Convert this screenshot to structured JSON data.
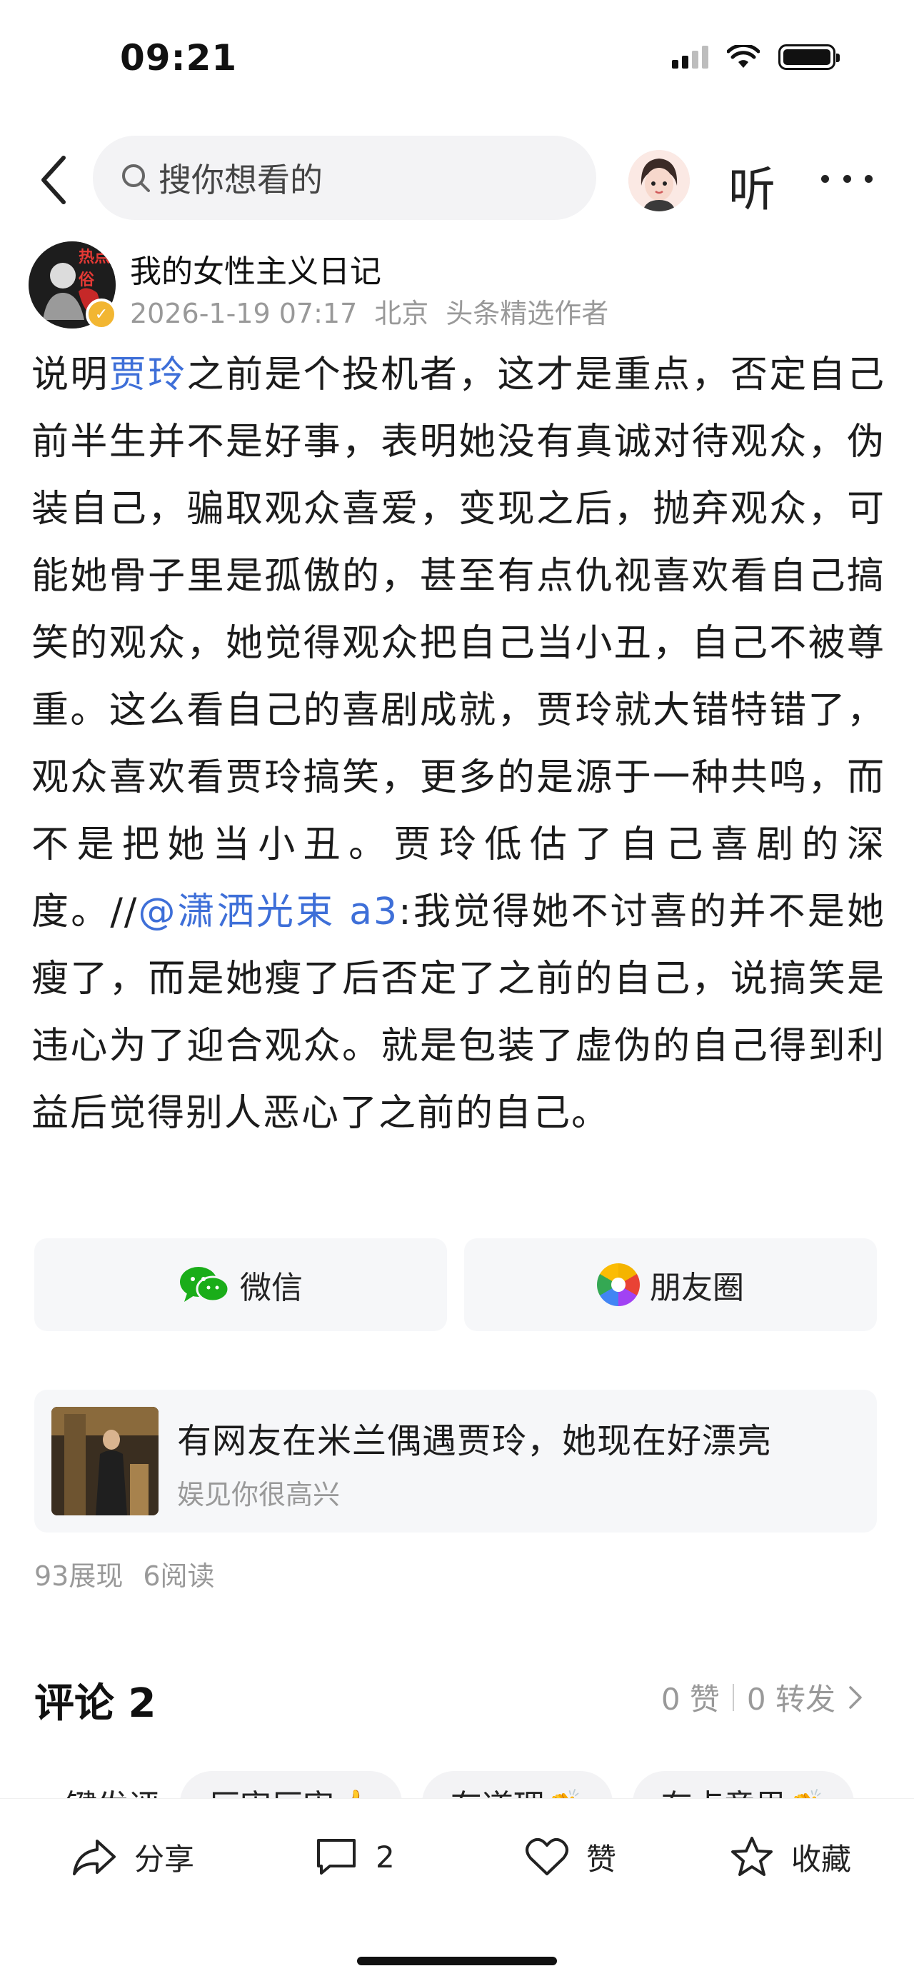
{
  "status_bar": {
    "time": "09:21"
  },
  "nav": {
    "search_placeholder": "搜你想看的",
    "listen_label": "听"
  },
  "author": {
    "name": "我的女性主义日记",
    "date": "2026-1-19 07:17",
    "location": "北京",
    "tag": "头条精选作者",
    "avatar_badge": "热点俗"
  },
  "post": {
    "seg1": "说明",
    "link1": "贾玲",
    "seg2": "之前是个投机者，这才是重点，否定自己前半生并不是好事，表明她没有真诚对待观众，伪装自己，骗取观众喜爱，变现之后，抛弃观众，可能她骨子里是孤傲的，甚至有点仇视喜欢看自己搞笑的观众，她觉得观众把自己当小丑，自己不被尊重。这么看自己的喜剧成就，贾玲就大错特错了，观众喜欢看贾玲搞笑，更多的是源于一种共鸣，而不是把她当小丑。贾玲低估了自己喜剧的深度。//",
    "link2": "@潇洒光束 a3",
    "seg3": ":我觉得她不讨喜的并不是她瘦了，而是她瘦了后否定了之前的自己，说搞笑是违心为了迎合观众。就是包装了虚伪的自己得到利益后觉得别人恶心了之前的自己。"
  },
  "share": {
    "wechat_label": "微信",
    "moments_label": "朋友圈"
  },
  "related": {
    "title": "有网友在米兰偶遇贾玲，她现在好漂亮",
    "source": "娱见你很高兴"
  },
  "stats": {
    "views": "93展现",
    "reads": "6阅读"
  },
  "comments": {
    "title": "评论 2",
    "likes": "0 赞",
    "reposts": "0 转发"
  },
  "quick_comments": {
    "label": "一键发评",
    "chips": [
      "厉害厉害👍",
      "有道理👏",
      "有点意思👏"
    ]
  },
  "bottom_bar": {
    "share_label": "分享",
    "comment_count": "2",
    "like_label": "赞",
    "favorite_label": "收藏"
  },
  "colors": {
    "link": "#3e6fd8",
    "meta_gray": "#999999",
    "card_bg": "#f6f7f9"
  }
}
